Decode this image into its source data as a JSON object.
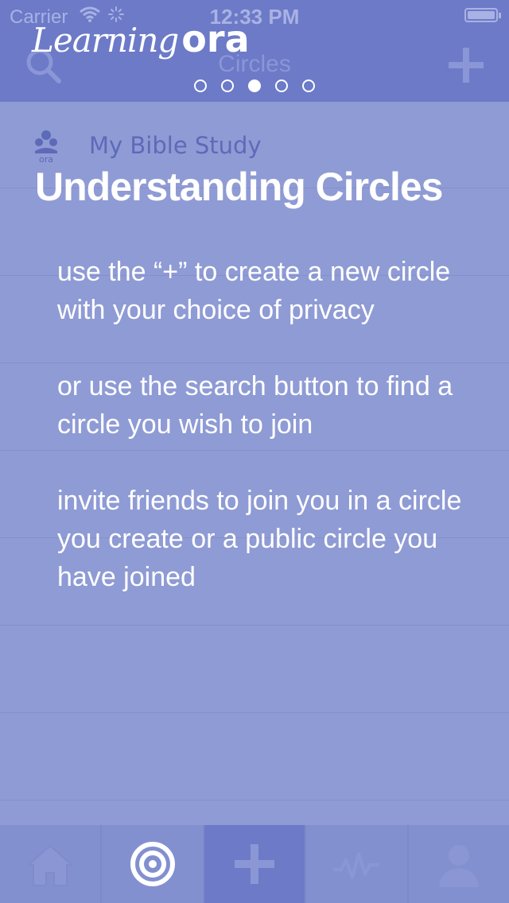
{
  "status_bar": {
    "carrier": "Carrier",
    "time": "12:33 PM"
  },
  "nav_bar": {
    "title": "Circles",
    "left_icon": "search-icon",
    "right_icon": "plus-icon"
  },
  "overlay": {
    "brand_script": "Learning",
    "brand_ora": "ora",
    "page_count": 5,
    "active_page": 3,
    "circle_logo_text": "ora",
    "circle_name": "My Bible Study",
    "heading": "Understanding Circles",
    "tips": [
      "use the “+” to create a new circle with your choice of privacy",
      "or use the search button to find a circle you wish to join",
      "invite friends to join you in a circle you create or a public circle you have joined"
    ]
  },
  "tab_bar": {
    "tabs": [
      {
        "icon": "home-icon"
      },
      {
        "icon": "target-icon"
      },
      {
        "icon": "plus-icon"
      },
      {
        "icon": "activity-icon"
      },
      {
        "icon": "profile-icon"
      }
    ]
  },
  "colors": {
    "nav_background": "#6c7ac8",
    "page_background": "#8f9bd4",
    "text_on_overlay": "#ffffff",
    "circle_name_color": "#5d6ab8"
  }
}
